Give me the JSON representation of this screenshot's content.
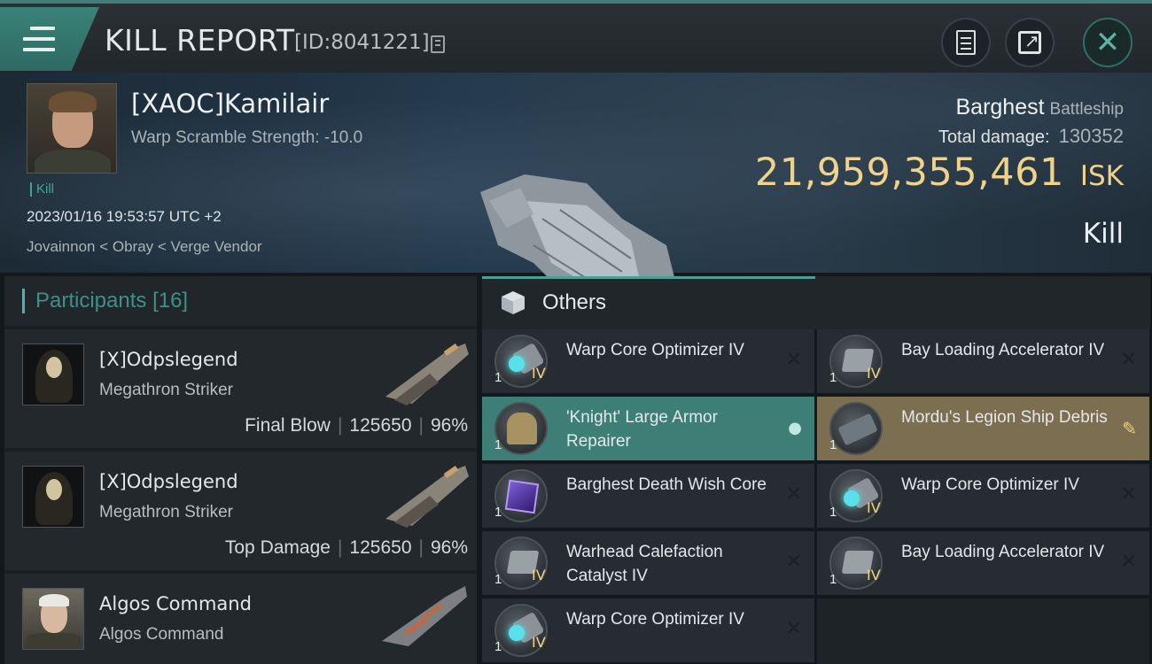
{
  "header": {
    "title": "KILL REPORT",
    "report_id": "[ID:8041221]",
    "icons": [
      "menu-icon",
      "copy-icon",
      "clipboard-icon",
      "share-icon",
      "close-icon"
    ]
  },
  "victim": {
    "name": "[XAOC]Kamilair",
    "warp_scramble": "Warp Scramble Strength: -10.0",
    "kill_tag": "Kill",
    "datetime": "2023/01/16 19:53:57 UTC +2",
    "location": "Jovainnon < Obray < Verge Vendor"
  },
  "ship": {
    "name": "Barghest",
    "class": "Battleship",
    "total_damage_label": "Total damage:",
    "total_damage": "130352",
    "isk_value": "21,959,355,461",
    "isk_unit": "ISK",
    "result": "Kill"
  },
  "participants": {
    "label": "Participants",
    "count": "[16]",
    "rows": [
      {
        "name": "[X]Odpslegend",
        "ship": "Megathron Striker",
        "role": "Final Blow",
        "damage": "125650",
        "percent": "96%"
      },
      {
        "name": "[X]Odpslegend",
        "ship": "Megathron Striker",
        "role": "Top Damage",
        "damage": "125650",
        "percent": "96%"
      },
      {
        "name": "Algos Command",
        "ship": "Algos Command"
      }
    ]
  },
  "others": {
    "label": "Others",
    "items": [
      {
        "name": "Warp Core Optimizer IV",
        "qty": "1",
        "tier": "IV",
        "status": "destroyed"
      },
      {
        "name": "Bay Loading Accelerator IV",
        "qty": "1",
        "tier": "IV",
        "status": "destroyed"
      },
      {
        "name": "'Knight' Large Armor Repairer",
        "qty": "1",
        "tier": "",
        "status": "dropped"
      },
      {
        "name": "Mordu's Legion Ship Debris",
        "qty": "1",
        "tier": "",
        "status": "salvage"
      },
      {
        "name": "Barghest Death Wish Core",
        "qty": "1",
        "tier": "",
        "status": "destroyed"
      },
      {
        "name": "Warp Core Optimizer IV",
        "qty": "1",
        "tier": "IV",
        "status": "destroyed"
      },
      {
        "name": "Warhead Calefaction Catalyst IV",
        "qty": "1",
        "tier": "IV",
        "status": "destroyed"
      },
      {
        "name": "Bay Loading Accelerator IV",
        "qty": "1",
        "tier": "IV",
        "status": "destroyed"
      },
      {
        "name": "Warp Core Optimizer IV",
        "qty": "1",
        "tier": "IV",
        "status": "destroyed"
      }
    ],
    "status_glyphs": {
      "destroyed": "✕",
      "dropped": "👤",
      "salvage": "🔧"
    }
  },
  "colors": {
    "accent": "#3f9088",
    "isk": "#f1d28a",
    "dropped_bg": "#3d7f77",
    "salvage_bg": "#7c6e50"
  }
}
